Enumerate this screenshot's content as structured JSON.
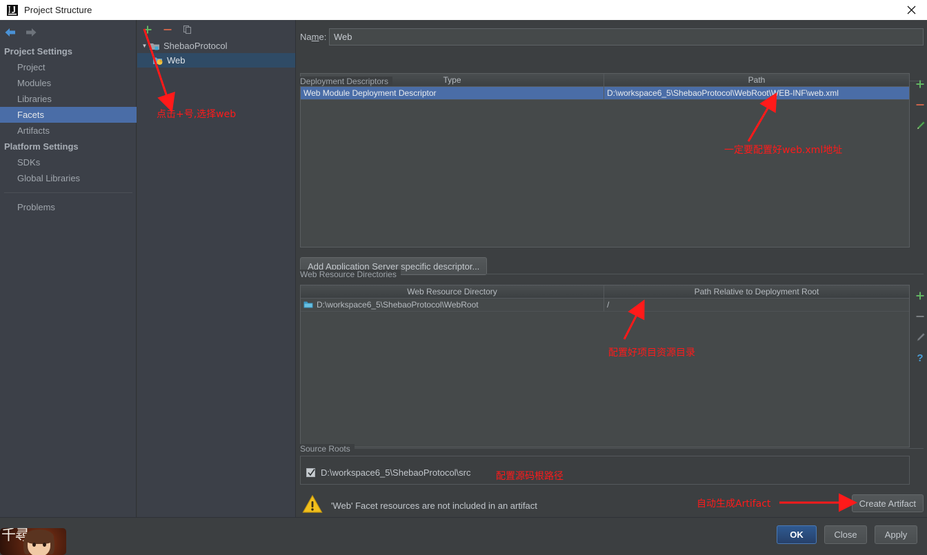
{
  "window": {
    "title": "Project Structure",
    "app_icon": "intellij-idea-icon",
    "close_icon": "close-icon"
  },
  "sidebar": {
    "nav": {
      "back_icon": "arrow-left-icon",
      "forward_icon": "arrow-right-icon"
    },
    "groups": [
      {
        "label": "Project Settings",
        "items": [
          {
            "label": "Project",
            "selected": false
          },
          {
            "label": "Modules",
            "selected": false
          },
          {
            "label": "Libraries",
            "selected": false
          },
          {
            "label": "Facets",
            "selected": true
          },
          {
            "label": "Artifacts",
            "selected": false
          }
        ]
      },
      {
        "label": "Platform Settings",
        "items": [
          {
            "label": "SDKs",
            "selected": false
          },
          {
            "label": "Global Libraries",
            "selected": false
          }
        ]
      }
    ],
    "problems": {
      "label": "Problems"
    }
  },
  "tree": {
    "toolbar": [
      {
        "name": "add-facet-button",
        "icon": "plus-icon",
        "label": "+"
      },
      {
        "name": "remove-facet-button",
        "icon": "minus-icon",
        "label": "−"
      },
      {
        "name": "copy-facet-button",
        "icon": "copy-icon",
        "label": ""
      }
    ],
    "nodes": [
      {
        "label": "ShebaoProtocol",
        "icon": "module-folder-icon",
        "expanded": true,
        "selected": false,
        "level": 0
      },
      {
        "label": "Web",
        "icon": "web-facet-icon",
        "expanded": false,
        "selected": true,
        "level": 1
      }
    ]
  },
  "facet": {
    "name_label": "Name:",
    "name_label_prefix": "Na",
    "name_label_accel": "m",
    "name_label_suffix": "e:",
    "name_value": "Web",
    "deployment_descriptors": {
      "group_label": "Deployment Descriptors",
      "columns": [
        "Type",
        "Path"
      ],
      "rows": [
        {
          "type": "Web Module Deployment Descriptor",
          "path": "D:\\workspace6_5\\ShebaoProtocol\\WebRoot\\WEB-INF\\web.xml",
          "selected": true
        }
      ],
      "tools": [
        {
          "name": "add-descriptor-button",
          "icon": "plus-icon"
        },
        {
          "name": "remove-descriptor-button",
          "icon": "minus-icon"
        },
        {
          "name": "edit-descriptor-button",
          "icon": "pencil-icon"
        }
      ],
      "add_server_descriptor_button": "Add Application Server specific descriptor..."
    },
    "web_resource_directories": {
      "group_label": "Web Resource Directories",
      "columns": [
        "Web Resource Directory",
        "Path Relative to Deployment Root"
      ],
      "rows": [
        {
          "directory": "D:\\workspace6_5\\ShebaoProtocol\\WebRoot",
          "relative_path": "/",
          "icon": "folder-icon"
        }
      ],
      "tools": [
        {
          "name": "add-web-resource-button",
          "icon": "plus-icon"
        },
        {
          "name": "remove-web-resource-button",
          "icon": "minus-icon"
        },
        {
          "name": "edit-web-resource-button",
          "icon": "pencil-icon"
        },
        {
          "name": "help-button",
          "icon": "question-mark-icon"
        }
      ]
    },
    "source_roots": {
      "group_label": "Source Roots",
      "rows": [
        {
          "path": "D:\\workspace6_5\\ShebaoProtocol\\src",
          "checked": true
        }
      ]
    },
    "warning": {
      "icon": "warning-triangle-icon",
      "message": "'Web' Facet resources are not included in an artifact",
      "action_button": "Create Artifact"
    }
  },
  "annotations": [
    {
      "name": "annotation-click-plus",
      "text": "点击+号,选择web"
    },
    {
      "name": "annotation-webxml-path",
      "text": "一定要配置好web.xml地址"
    },
    {
      "name": "annotation-resource-dir",
      "text": "配置好项目资源目录"
    },
    {
      "name": "annotation-source-root",
      "text": "配置源码根路径"
    },
    {
      "name": "annotation-create-artifact",
      "text": "自动生成Artifact"
    }
  ],
  "dialog_buttons": {
    "ok": "OK",
    "close": "Close",
    "apply": "Apply"
  },
  "colors": {
    "accent_selection": "#4a6da7",
    "tree_selection": "#2f4b66",
    "annotation_red": "#ff1a1a",
    "window_bg": "#3c3f41",
    "sidebar_bg": "#3c4048",
    "warning_yellow": "#f0c01e",
    "ok_button_blue": "#2f5a91"
  }
}
